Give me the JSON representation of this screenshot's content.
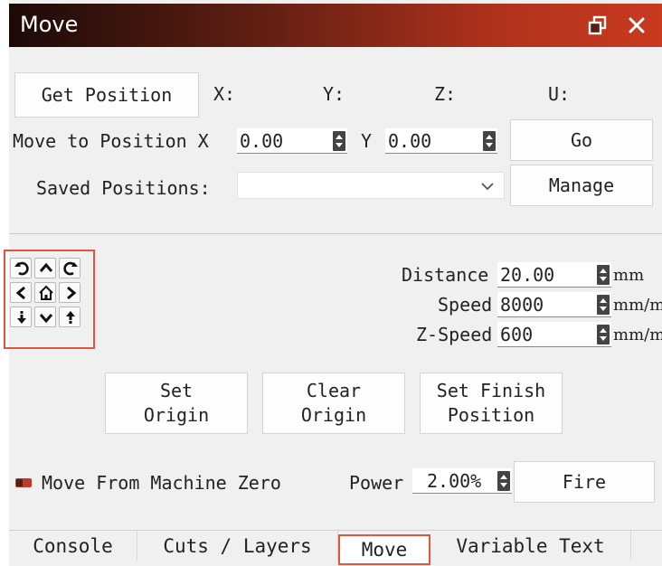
{
  "window": {
    "title": "Move",
    "float_icon": "restore-window-icon",
    "close_icon": "close-icon"
  },
  "position": {
    "get_position_label": "Get Position",
    "x_label": "X:",
    "y_label": "Y:",
    "z_label": "Z:",
    "u_label": "U:"
  },
  "move_to": {
    "label": "Move to Position X",
    "x_value": "0.00",
    "y_label": "Y",
    "y_value": "0.00",
    "go_label": "Go"
  },
  "saved": {
    "label": "Saved Positions:",
    "value": "",
    "manage_label": "Manage"
  },
  "jog": {
    "icons": [
      "rotate-ccw-icon",
      "up-arrow-icon",
      "rotate-cw-icon",
      "left-arrow-icon",
      "home-icon",
      "right-arrow-icon",
      "z-down-icon",
      "down-arrow-icon",
      "z-up-icon"
    ]
  },
  "params": {
    "distance_label": "Distance",
    "distance_value": "20.00",
    "distance_unit": "mm",
    "speed_label": "Speed",
    "speed_value": "8000",
    "speed_unit": "mm/m",
    "zspeed_label": "Z-Speed",
    "zspeed_value": "600",
    "zspeed_unit": "mm/m"
  },
  "actions": {
    "set_origin_label": "Set\nOrigin",
    "clear_origin_label": "Clear\nOrigin",
    "set_finish_label": "Set Finish\nPosition"
  },
  "bottom": {
    "machine_zero_label": "Move From Machine Zero",
    "power_label": "Power",
    "power_value": "2.00%",
    "fire_label": "Fire"
  },
  "tabs": [
    {
      "label": "Console",
      "active": false
    },
    {
      "label": "Cuts / Layers",
      "active": false
    },
    {
      "label": "Move",
      "active": true
    },
    {
      "label": "Variable Text",
      "active": false
    }
  ],
  "colors": {
    "title_gradient_start": "#1c0a08",
    "title_gradient_end": "#c93a20",
    "highlight_red": "#e5533c",
    "toggle_red": "#c0392b"
  }
}
